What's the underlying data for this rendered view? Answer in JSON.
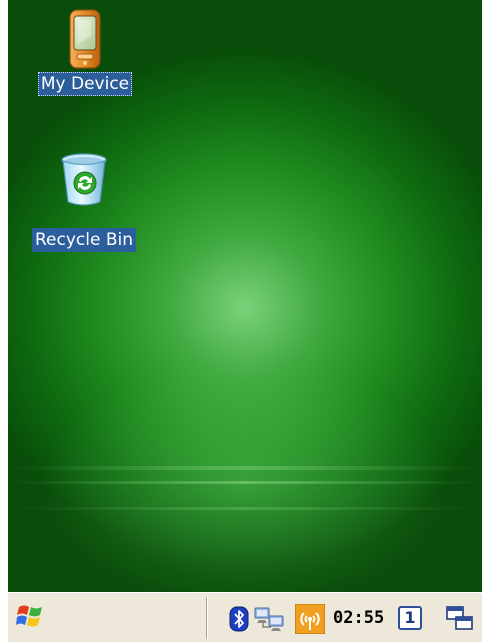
{
  "desktop": {
    "icons": [
      {
        "label": "My Device",
        "icon": "pda-device-icon"
      },
      {
        "label": "Recycle Bin",
        "icon": "recycle-bin-icon"
      }
    ]
  },
  "taskbar": {
    "start_icon": "windows-flag-icon",
    "tray_icons": [
      "bluetooth-icon",
      "network-connection-icon",
      "wireless-signal-icon"
    ],
    "clock": "02:55",
    "desktop_number": "1",
    "switch_icon": "window-switch-icon"
  },
  "colors": {
    "desktop_green": "#1f8a1f",
    "selection_blue": "#2d5e9c",
    "taskbar_beige": "#ede8da",
    "bluetooth_blue": "#1e3fbf",
    "wireless_orange": "#f0a020"
  }
}
